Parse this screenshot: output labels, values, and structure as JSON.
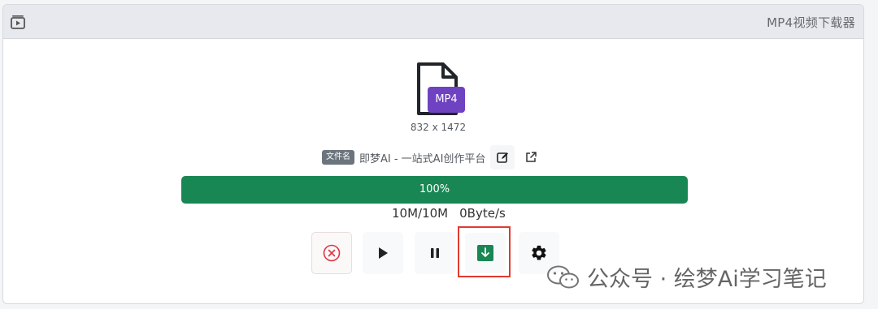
{
  "window": {
    "title": "MP4视频下载器"
  },
  "file": {
    "type_badge": "MP4",
    "dimensions": "832 x 1472",
    "filename_label": "文件名",
    "filename": "即梦AI - 一站式AI创作平台"
  },
  "progress": {
    "percent": 100,
    "label": "100%",
    "size": "10M/10M",
    "speed": "0Byte/s"
  },
  "controls": {
    "cancel_icon": "circle-x-icon",
    "play_icon": "play-icon",
    "pause_icon": "pause-icon",
    "download_icon": "download-icon",
    "settings_icon": "gear-icon"
  },
  "colors": {
    "progress": "#198754",
    "badge": "#6f42c1",
    "cancel": "#dc3545",
    "highlight": "#e03a2f"
  },
  "watermark": {
    "text": "公众号 · 绘梦Ai学习笔记"
  }
}
